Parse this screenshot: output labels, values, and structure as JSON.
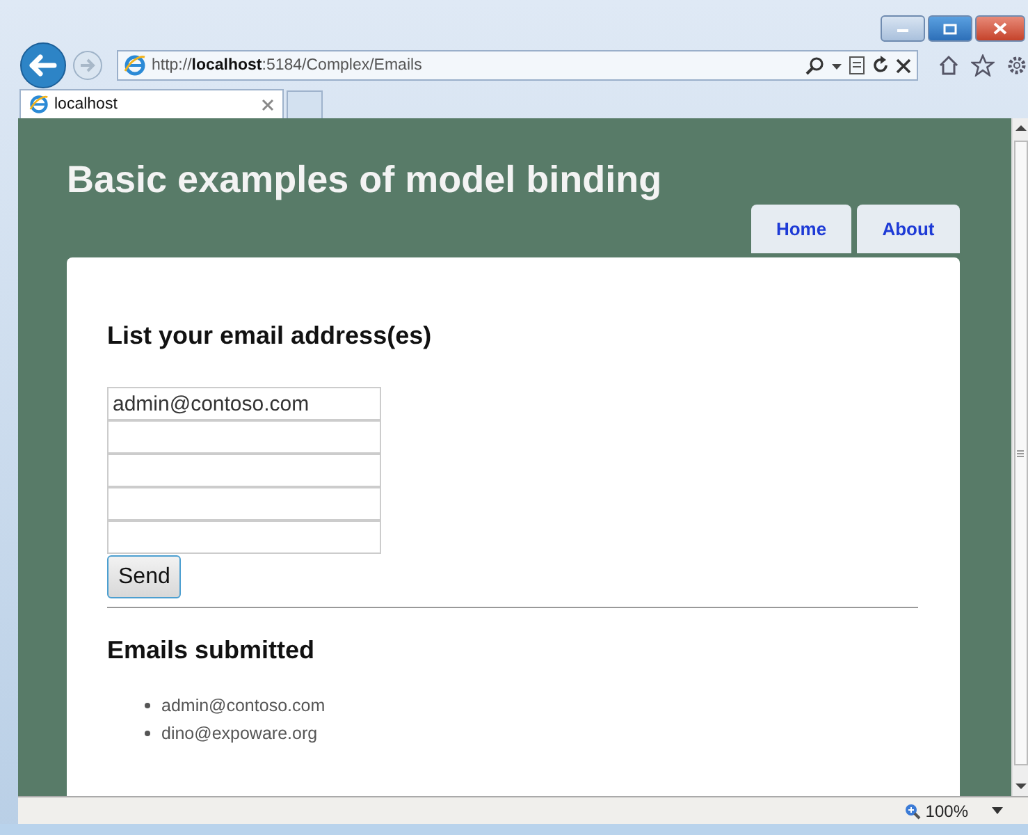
{
  "browser": {
    "address": "http://**localhost**:5184/Complex/Emails",
    "tabs": [
      {
        "label": "localhost",
        "selected": true
      }
    ],
    "zoom": "100%"
  },
  "page": {
    "title": "Basic examples of model binding",
    "nav": [
      {
        "label": "Home"
      },
      {
        "label": "About"
      }
    ],
    "form_heading": "List your email address(es)",
    "email_fields": [
      {
        "kind": "filled",
        "value": "admin@contoso.com"
      },
      {
        "kind": "blank"
      },
      {
        "kind": "blank"
      },
      {
        "kind": "blank"
      },
      {
        "kind": "blank"
      }
    ],
    "submit": "Send",
    "results_heading": "Emails submitted",
    "results": [
      "admin@contoso.com",
      "dino@expoware.org"
    ]
  }
}
